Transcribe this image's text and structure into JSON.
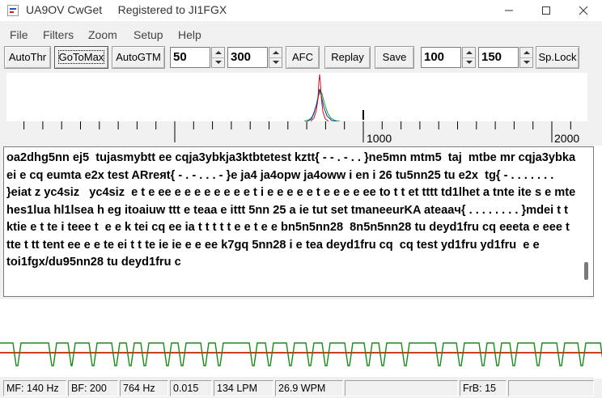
{
  "window": {
    "app_name": "UA9OV CwGet",
    "registration": "Registered to JI1FGX"
  },
  "menu": [
    "File",
    "Filters",
    "Zoom",
    "Setup",
    "Help"
  ],
  "toolbar": {
    "auto_threshold": "AutoThr",
    "go_to_max": "GoToMax",
    "auto_gtm": "AutoGTM",
    "field1": "50",
    "field2": "300",
    "afc": "AFC",
    "replay": "Replay",
    "save": "Save",
    "field3": "100",
    "field4": "150",
    "sp_lock": "Sp.Lock"
  },
  "scale": {
    "label_1000": "1000",
    "label_2000": "2000"
  },
  "decoder": {
    "text": "oa2dhg5nn ej5  tujasmybtt ee cqja3ybkja3ktbtetest kztt{ - - . - . . }ne5mn mtm5  taj  mtbe mr cqja3ybka ei e cq eumta e2x test ARrеяt{ - . - . . . - }e ja4 ja4opw ja4oww i en i 26 tu5nn25 tu e2x  tg{ - . . . . . . . }eiat z yc4siz   yc4siz  e t e ee e e e e e e e e t i e e e e e t e e e e ee to t t et tttt td1lhet a tnte ite s e mte hes1lua hl1lsea h eg itoaiuw ttt e teaa e ittt 5nn 25 a ie tut set tmaneeurKA ateaaч{ . . . . . . . . }mdei t t ktie e t te i teee t  e e k tei cq ee ia t t t t t e e t e e bn5n5nn28  8n5n5nn28 tu deyd1fru cq eeeta e eee t tte t tt tent ee e e te ei t t te ie ie e e ee k7gq 5nn28 i e tea deyd1fru cq  cq test yd1fru yd1fru  e e toi1fgx/du95nn28 tu deyd1fru c"
  },
  "status": {
    "mf": "MF: 140 Hz",
    "bf": "BF: 200",
    "freq": "764 Hz",
    "level": "0.015",
    "lpm": "134 LPM",
    "wpm": "26.9 WPM",
    "frb": "FrB: 15"
  },
  "colors": {
    "signal_trace": "#1a8a1a",
    "threshold_line": "#d04020",
    "spectrum_red": "#d01010",
    "spectrum_blue": "#1030c0",
    "spectrum_green": "#10a020"
  },
  "icons": {
    "minimize": "minimize-icon",
    "maximize": "maximize-icon",
    "close": "close-icon",
    "spin_up": "chevron-up-icon",
    "spin_down": "chevron-down-icon"
  }
}
